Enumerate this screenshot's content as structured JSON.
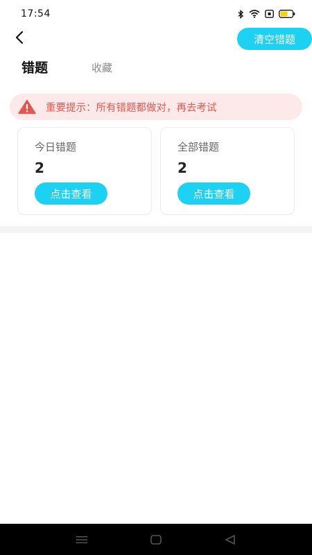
{
  "status_bar": {
    "time": "17:54",
    "icons": [
      "bluetooth-icon",
      "wifi-icon",
      "sim-icon",
      "battery-icon"
    ],
    "battery_color": "#f5d20a"
  },
  "header": {
    "back_icon": "chevron-left-icon",
    "clear_label": "清空错题"
  },
  "tabs": [
    {
      "label": "错题",
      "active": true
    },
    {
      "label": "收藏",
      "active": false
    }
  ],
  "alert": {
    "icon": "warning-icon",
    "text": "重要提示：所有错题都做对，再去考试",
    "background": "#fde9ea",
    "color": "#e0584d"
  },
  "cards": [
    {
      "title": "今日错题",
      "count": "2",
      "button_label": "点击查看"
    },
    {
      "title": "全部错题",
      "count": "2",
      "button_label": "点击查看"
    }
  ],
  "colors": {
    "accent": "#1cd1f2"
  },
  "nav_bar": {
    "icons": [
      "menu-icon",
      "home-square-icon",
      "back-triangle-icon"
    ]
  }
}
